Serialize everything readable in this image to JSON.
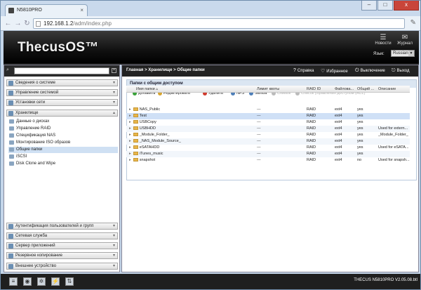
{
  "browser": {
    "tab_title": "N5810PRO",
    "address_host": "192.168.1.2",
    "address_path": "/adm/index.php",
    "window_buttons": [
      "–",
      "□",
      "x"
    ]
  },
  "header": {
    "logo": "ThecusOS™",
    "news_label": "Новости",
    "journal_label": "Журнал",
    "lang_label": "Язык:",
    "lang_value": "Russian"
  },
  "sidebar": {
    "sections_top": [
      {
        "label": "Сведения о системе",
        "icon": "info-icon"
      },
      {
        "label": "Управление системой",
        "icon": "system-icon"
      },
      {
        "label": "Установки сети",
        "icon": "network-icon"
      },
      {
        "label": "Хранилище",
        "icon": "storage-icon"
      }
    ],
    "storage_items": [
      "Данные о дисках",
      "Управление RAID",
      "Спецификация NAS",
      "Монтирование ISO образов",
      "Общие папки",
      "iSCSI",
      "Disk Clone and Wipe"
    ],
    "selected_item": "Общие папки",
    "sections_bottom": [
      "Аутентификация пользователей и групп",
      "Сетевая служба",
      "Сервер приложений",
      "Резервное копирование",
      "Внешнее устройство"
    ]
  },
  "main": {
    "breadcrumb": "Главная > Хранилище > Общие папки",
    "help": "Справка",
    "favorites": "Избранное",
    "shutdown": "Выключение",
    "logout": "Выход",
    "panel_title": "Папки с общим доступом",
    "toolbar": {
      "add": "Добавить",
      "edit": "Редактировать",
      "delete": "Удалить",
      "nfs": "NFS",
      "samba": "Samba",
      "snapshot": "Снимок",
      "acl": "Список управления доступом (ACL)"
    },
    "columns": [
      "Имя папки",
      "Лимит квоты",
      "RAID ID",
      "Файлова...",
      "Общий ...",
      "Описание"
    ],
    "rows": [
      {
        "name": "NAS_Public",
        "quota": "---",
        "raid": "RAID",
        "fs": "ext4",
        "shared": "yes",
        "desc": ""
      },
      {
        "name": "Test",
        "quota": "---",
        "raid": "RAID",
        "fs": "ext4",
        "shared": "yes",
        "desc": ""
      },
      {
        "name": "USBCopy",
        "quota": "---",
        "raid": "RAID",
        "fs": "ext4",
        "shared": "yes",
        "desc": ""
      },
      {
        "name": "USBHDD",
        "quota": "---",
        "raid": "RAID",
        "fs": "ext4",
        "shared": "yes",
        "desc": "Used for extern..."
      },
      {
        "name": "_Module_Folder_",
        "quota": "---",
        "raid": "RAID",
        "fs": "ext4",
        "shared": "yes",
        "desc": "_Module_Folder_"
      },
      {
        "name": "_NAS_Module_Source_",
        "quota": "---",
        "raid": "RAID",
        "fs": "ext4",
        "shared": "yes",
        "desc": ""
      },
      {
        "name": "eSATAHDD",
        "quota": "---",
        "raid": "RAID",
        "fs": "ext4",
        "shared": "yes",
        "desc": "Used for eSATA..."
      },
      {
        "name": "iTunes_music",
        "quota": "---",
        "raid": "RAID",
        "fs": "ext4",
        "shared": "yes",
        "desc": ""
      },
      {
        "name": "snapshot",
        "quota": "---",
        "raid": "RAID",
        "fs": "ext4",
        "shared": "no",
        "desc": "Used for snapsh..."
      }
    ]
  },
  "status": {
    "version": "THECUS N5810PRO V2.05.08.btl"
  }
}
